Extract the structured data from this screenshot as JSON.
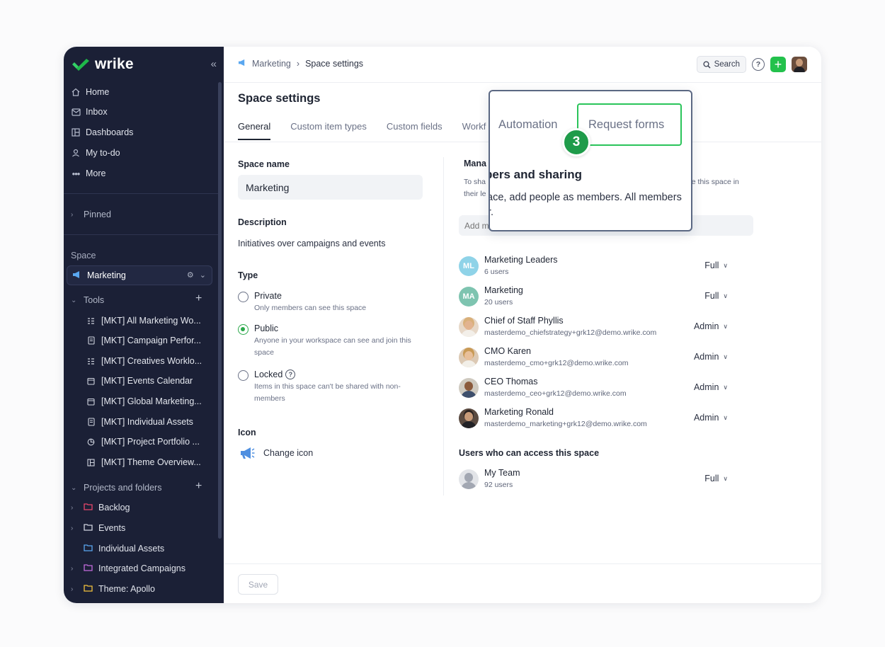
{
  "app": {
    "logo_text": "wrike"
  },
  "sidebar": {
    "nav": [
      {
        "label": "Home",
        "icon": "home-icon"
      },
      {
        "label": "Inbox",
        "icon": "inbox-icon"
      },
      {
        "label": "Dashboards",
        "icon": "dashboards-icon"
      },
      {
        "label": "My to-do",
        "icon": "user-todo-icon"
      },
      {
        "label": "More",
        "icon": "more-icon"
      }
    ],
    "pinned_label": "Pinned",
    "space_section_label": "Space",
    "space_selected": "Marketing",
    "tools_label": "Tools",
    "tools": [
      "[MKT] All Marketing Wo...",
      "[MKT] Campaign Perfor...",
      "[MKT] Creatives Worklo...",
      "[MKT] Events Calendar",
      "[MKT] Global Marketing...",
      "[MKT] Individual Assets",
      "[MKT] Project Portfolio ...",
      "[MKT] Theme Overview..."
    ],
    "projects_label": "Projects and folders",
    "folders": [
      {
        "label": "Backlog",
        "color": "#e8466b",
        "expandable": true
      },
      {
        "label": "Events",
        "color": "#cfd3de",
        "expandable": true
      },
      {
        "label": "Individual Assets",
        "color": "#5aa7f0",
        "expandable": false
      },
      {
        "label": "Integrated Campaigns",
        "color": "#c46bdc",
        "expandable": true
      },
      {
        "label": "Theme: Apollo",
        "color": "#f2c13c",
        "expandable": true
      }
    ]
  },
  "header": {
    "breadcrumb": [
      "Marketing",
      "Space settings"
    ],
    "search_label": "Search",
    "help_label": "?",
    "add_label": "+"
  },
  "page": {
    "title": "Space settings",
    "tabs": [
      "General",
      "Custom item types",
      "Custom fields",
      "Workf"
    ]
  },
  "general": {
    "space_name_label": "Space name",
    "space_name_value": "Marketing",
    "description_label": "Description",
    "description_value": "Initiatives over campaigns and events",
    "type_label": "Type",
    "types": [
      {
        "title": "Private",
        "desc": "Only members can see this space",
        "checked": false
      },
      {
        "title": "Public",
        "desc": "Anyone in your workspace can see and join this space",
        "checked": true
      },
      {
        "title": "Locked",
        "desc": "Items in this space can't be shared with non-members",
        "checked": false
      }
    ],
    "icon_label": "Icon",
    "change_icon_label": "Change icon"
  },
  "members": {
    "title": "Mana",
    "desc_part1": "To sha",
    "desc_part2": "ee this space in",
    "desc_part3": "their le",
    "add_placeholder": "Add m",
    "list": [
      {
        "name": "Marketing Leaders",
        "sub": "6 users",
        "role": "Full",
        "initials": "ML",
        "color": "#8fd3e8"
      },
      {
        "name": "Marketing",
        "sub": "20 users",
        "role": "Full",
        "initials": "MA",
        "color": "#7ec4b0"
      },
      {
        "name": "Chief of Staff Phyllis",
        "sub": "masterdemo_chiefstrategy+grk12@demo.wrike.com",
        "role": "Admin",
        "initials": "",
        "color": ""
      },
      {
        "name": "CMO Karen",
        "sub": "masterdemo_cmo+grk12@demo.wrike.com",
        "role": "Admin",
        "initials": "",
        "color": ""
      },
      {
        "name": "CEO Thomas",
        "sub": "masterdemo_ceo+grk12@demo.wrike.com",
        "role": "Admin",
        "initials": "",
        "color": ""
      },
      {
        "name": "Marketing Ronald",
        "sub": "masterdemo_marketing+grk12@demo.wrike.com",
        "role": "Admin",
        "initials": "",
        "color": ""
      }
    ],
    "users_access_label": "Users who can access this space",
    "team": {
      "name": "My Team",
      "sub": "92 users",
      "role": "Full"
    }
  },
  "footer": {
    "save_label": "Save"
  },
  "callout": {
    "tab_automation": "Automation",
    "tab_request_forms": "Request forms",
    "heading": "bers and sharing",
    "text_line1": "ace, add people as members. All members",
    "text_line2": "r.",
    "step_number": "3"
  },
  "colors": {
    "sidebar_bg": "#1b2036",
    "accent_green": "#23c14c",
    "highlight_green": "#2ac45a",
    "badge_green": "#1f9b4a"
  }
}
